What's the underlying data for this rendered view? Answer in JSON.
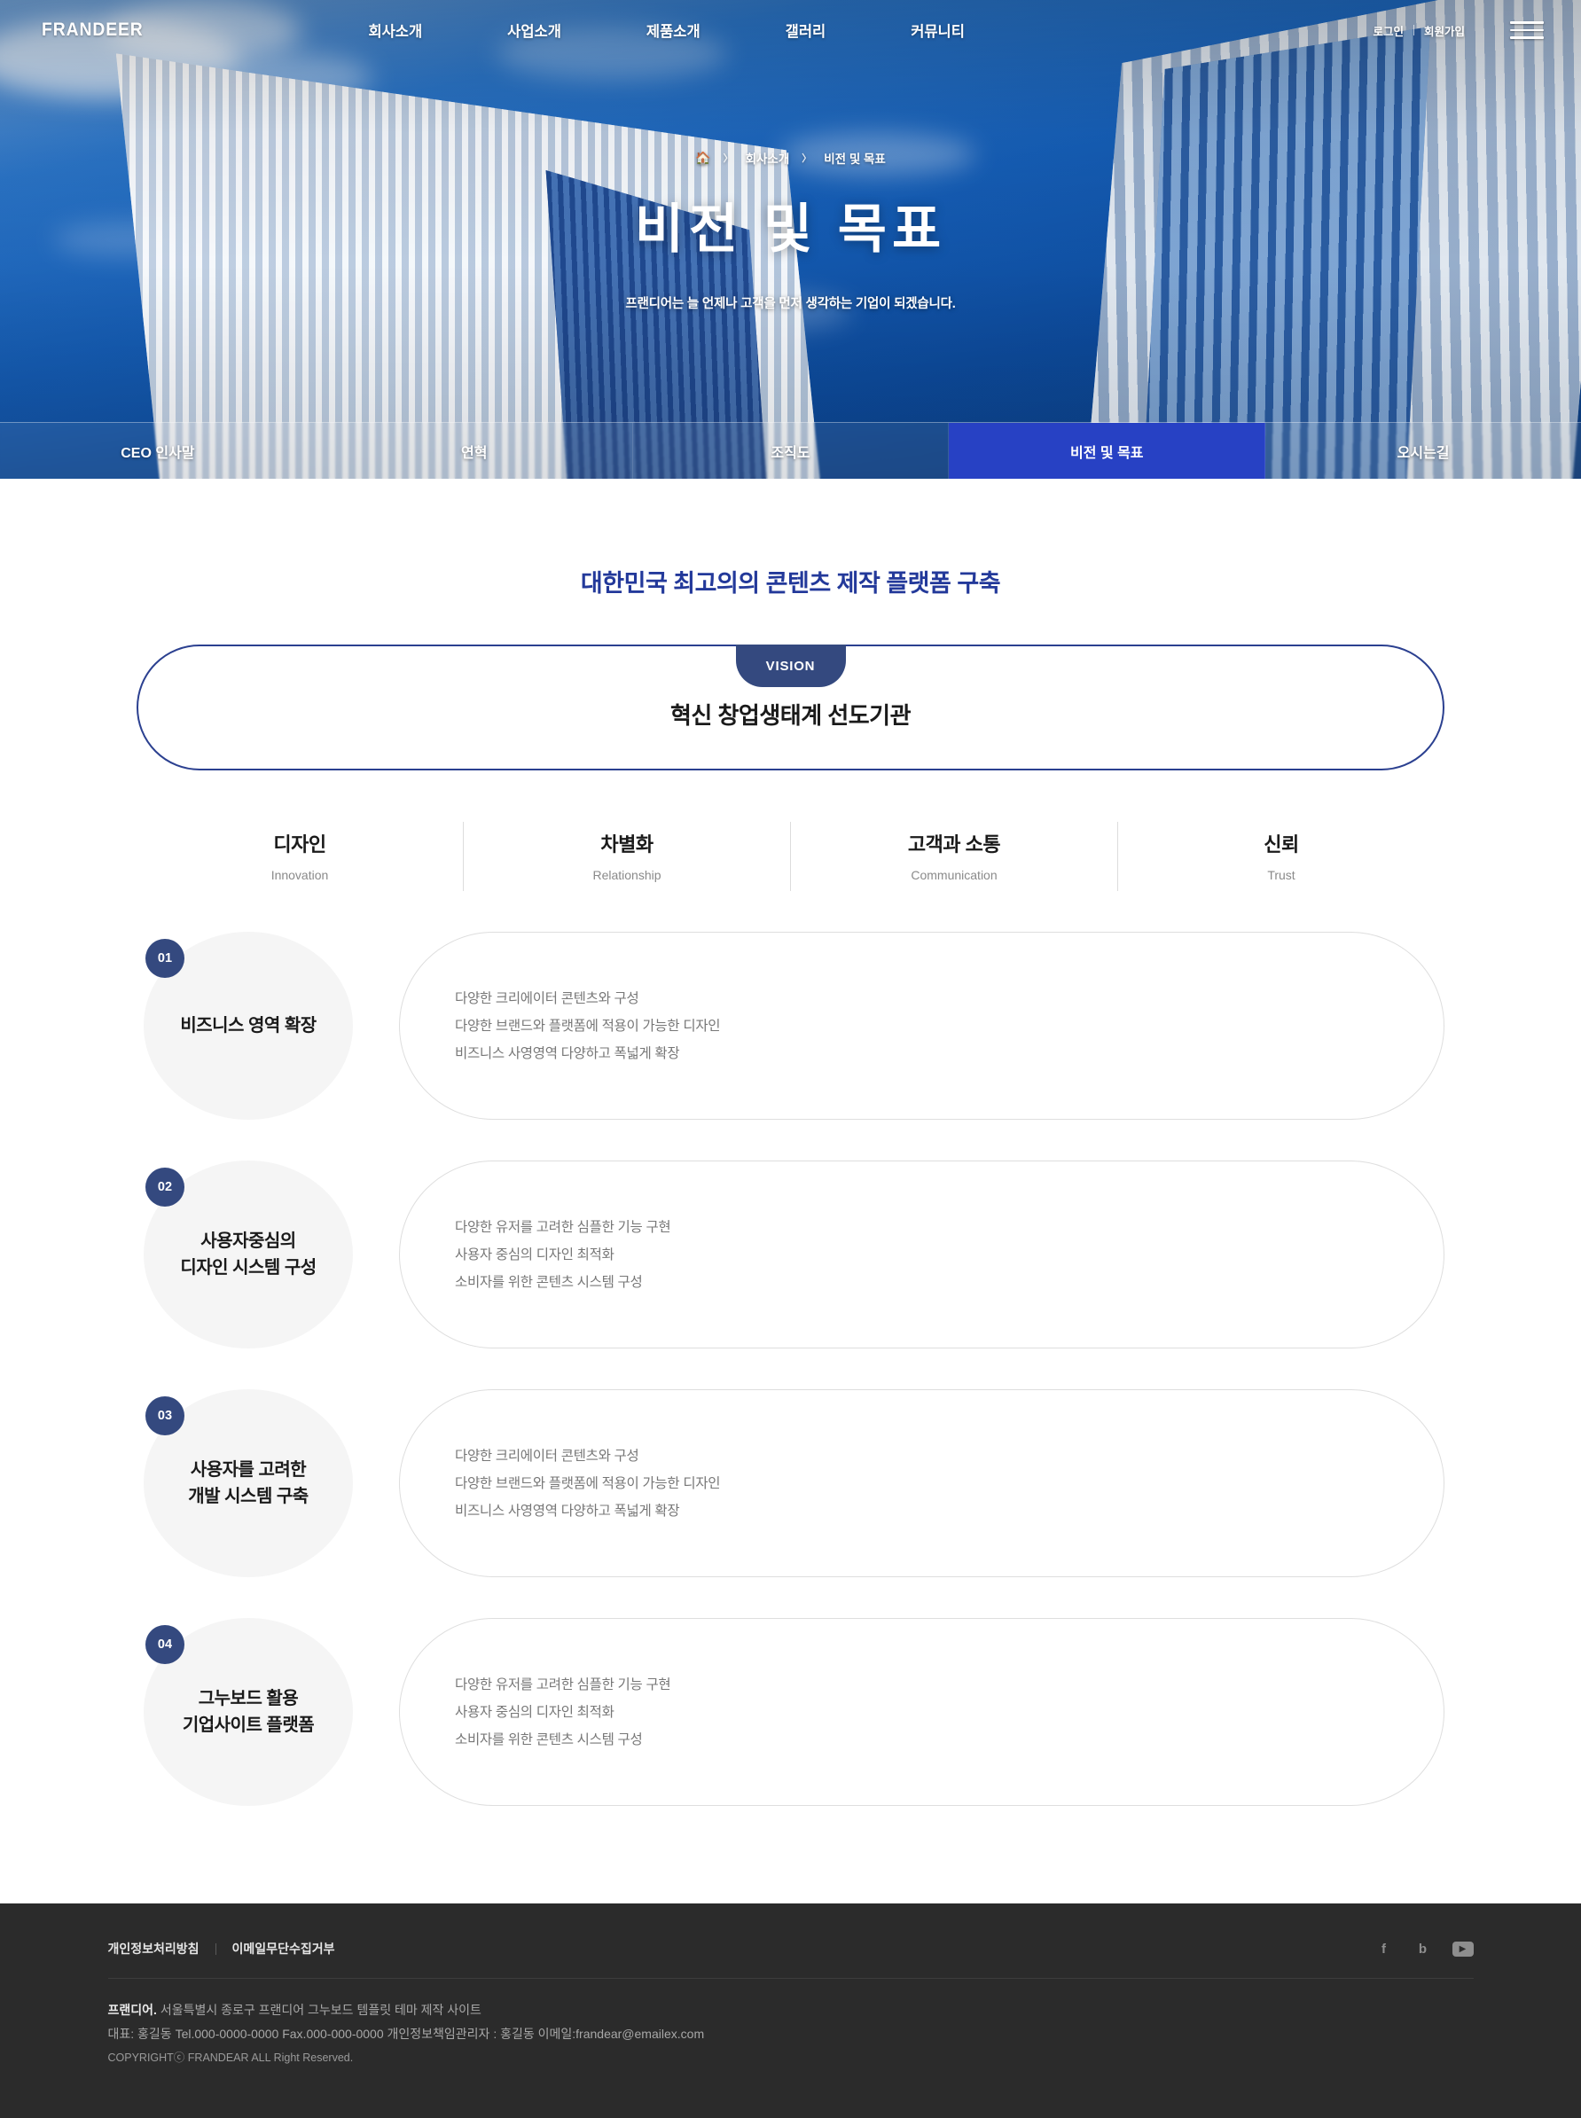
{
  "header": {
    "logo": "FRANDEER",
    "nav": [
      {
        "label": "회사소개"
      },
      {
        "label": "사업소개"
      },
      {
        "label": "제품소개"
      },
      {
        "label": "갤러리"
      },
      {
        "label": "커뮤니티"
      }
    ],
    "login_label": "로그인",
    "signup_label": "회원가입",
    "menu_icon": "hamburger-menu-icon"
  },
  "hero": {
    "breadcrumb": {
      "home_icon": "home-icon",
      "separator": "〉",
      "items": [
        "회사소개",
        "비전 및 목표"
      ]
    },
    "title": "비전 및 목표",
    "subtitle": "프랜디어는 늘 언제나 고객을 먼저 생각하는 기업이 되겠습니다.",
    "active_color": "#2741c4"
  },
  "tabs": [
    {
      "label": "CEO 인사말",
      "active": false
    },
    {
      "label": "연혁",
      "active": false
    },
    {
      "label": "조직도",
      "active": false
    },
    {
      "label": "비전 및 목표",
      "active": true
    },
    {
      "label": "오시는길",
      "active": false
    }
  ],
  "main": {
    "section_title": "대한민국 최고의의 콘텐츠 제작 플랫폼 구축",
    "section_title_color": "#23399a",
    "vision": {
      "badge": "VISION",
      "statement": "혁신 창업생태계 선도기관",
      "badge_color": "#34497f",
      "border_color": "#2b4090"
    },
    "values": [
      {
        "ko": "디자인",
        "en": "Innovation"
      },
      {
        "ko": "차별화",
        "en": "Relationship"
      },
      {
        "ko": "고객과 소통",
        "en": "Communication"
      },
      {
        "ko": "신뢰",
        "en": "Trust"
      }
    ],
    "items": [
      {
        "num": "01",
        "label_line1": "비즈니스 영역 확장",
        "label_line2": "",
        "lines": [
          "다양한 크리에이터 콘텐츠와 구성",
          "다양한 브랜드와 플랫폼에 적용이 가능한 디자인",
          "비즈니스 사영영역 다양하고 폭넓게 확장"
        ]
      },
      {
        "num": "02",
        "label_line1": "사용자중심의",
        "label_line2": "디자인 시스템 구성",
        "lines": [
          "다양한 유저를 고려한 심플한 기능 구현",
          "사용자 중심의 디자인 최적화",
          "소비자를 위한 콘텐츠 시스템 구성"
        ]
      },
      {
        "num": "03",
        "label_line1": "사용자를 고려한",
        "label_line2": "개발 시스템 구축",
        "lines": [
          "다양한 크리에이터 콘텐츠와 구성",
          "다양한 브랜드와 플랫폼에 적용이 가능한 디자인",
          "비즈니스 사영영역 다양하고 폭넓게 확장"
        ]
      },
      {
        "num": "04",
        "label_line1": "그누보드 활용",
        "label_line2": "기업사이트 플랫폼",
        "lines": [
          "다양한 유저를 고려한 심플한 기능 구현",
          "사용자 중심의 디자인 최적화",
          "소비자를 위한 콘텐츠 시스템 구성"
        ]
      }
    ]
  },
  "footer": {
    "links": [
      "개인정보처리방침",
      "이메일무단수집거부"
    ],
    "socials": [
      {
        "icon": "facebook-icon",
        "glyph": "f"
      },
      {
        "icon": "blog-icon",
        "glyph": "b"
      },
      {
        "icon": "youtube-icon",
        "glyph": "▶"
      }
    ],
    "company_name": "프랜디어.",
    "address": "서울특별시 종로구 프랜디어 그누보드 템플릿 테마 제작 사이트",
    "contact": "대표: 홍길동   Tel.000-0000-0000   Fax.000-000-0000  개인정보책임관리자 : 홍길동 이메일:frandear@emailex.com",
    "copyright": "COPYRIGHTⓒ FRANDEAR ALL Right Reserved.",
    "background": "#2b2b2b"
  }
}
